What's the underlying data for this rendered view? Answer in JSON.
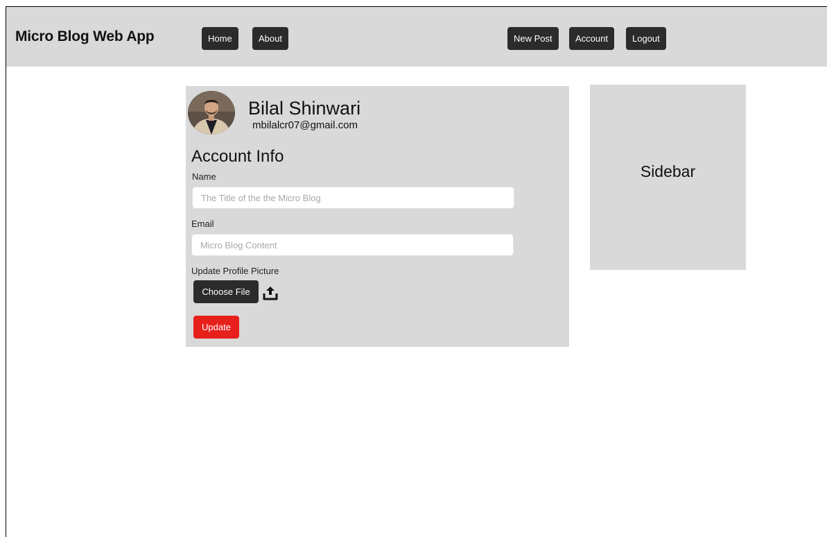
{
  "app": {
    "title": "Micro Blog Web App"
  },
  "nav": {
    "home": "Home",
    "about": "About",
    "new_post": "New Post",
    "account": "Account",
    "logout": "Logout"
  },
  "profile": {
    "name": "Bilal Shinwari",
    "email": "mbilalcr07@gmail.com"
  },
  "form": {
    "title": "Account Info",
    "name_label": "Name",
    "name_placeholder": "The Title of the the Micro Blog",
    "email_label": "Email",
    "email_placeholder": "Micro Blog Content",
    "picture_label": "Update Profile Picture",
    "choose_file": "Choose File",
    "update": "Update"
  },
  "sidebar": {
    "label": "Sidebar"
  },
  "colors": {
    "bar_background": "#d9d9d9",
    "button_dark": "#2b2b2b",
    "button_danger": "#e8201c"
  },
  "icons": {
    "upload": "upload-icon",
    "avatar": "avatar"
  }
}
